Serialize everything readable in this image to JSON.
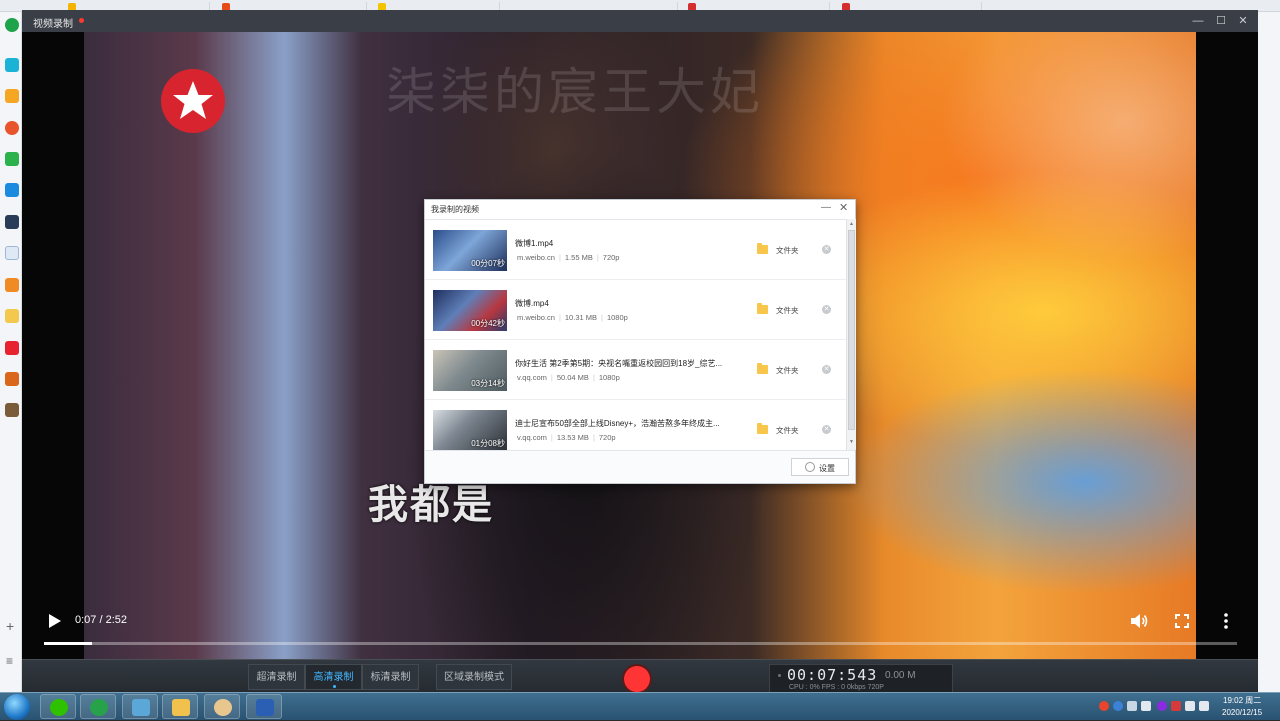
{
  "window": {
    "title": "视频录制"
  },
  "video": {
    "watermark": "柒柒的宸王大妃",
    "subtitle": "我都是",
    "time_display": "0:07 / 2:52",
    "progress": 0.04
  },
  "dialog": {
    "title": "我录制的视频",
    "folder_label": "文件夹",
    "settings_label": "设置",
    "items": [
      {
        "name": "微博1.mp4",
        "source": "m.weibo.cn",
        "size": "1.55 MB",
        "quality": "720p",
        "duration": "00分07秒"
      },
      {
        "name": "微博.mp4",
        "source": "m.weibo.cn",
        "size": "10.31 MB",
        "quality": "1080p",
        "duration": "00分42秒"
      },
      {
        "name": "你好生活 第2季第5期：央视名嘴重返校园回到18岁_综艺...",
        "source": "v.qq.com",
        "size": "50.04 MB",
        "quality": "1080p",
        "duration": "03分14秒"
      },
      {
        "name": "迪士尼宣布50部全部上线Disney+，浩瀚苦熬多年终成主...",
        "source": "v.qq.com",
        "size": "13.53 MB",
        "quality": "720p",
        "duration": "01分08秒"
      }
    ]
  },
  "controls": {
    "quality_options": [
      "超清录制",
      "高清录制",
      "标清录制"
    ],
    "active_quality": "高清录制",
    "region_mode": "区域录制模式",
    "timer": "00:07:543",
    "file_size": "0.00 M",
    "stats": "CPU : 0%   FPS : 0   0kbps   720P"
  },
  "taskbar": {
    "time": "19:02 周二",
    "date": "2020/12/15"
  },
  "colors": {
    "record_red": "#ff3535",
    "active_blue": "#40b8ff",
    "folder_yellow": "#f7c64a",
    "titlebar": "#3a3f47"
  }
}
